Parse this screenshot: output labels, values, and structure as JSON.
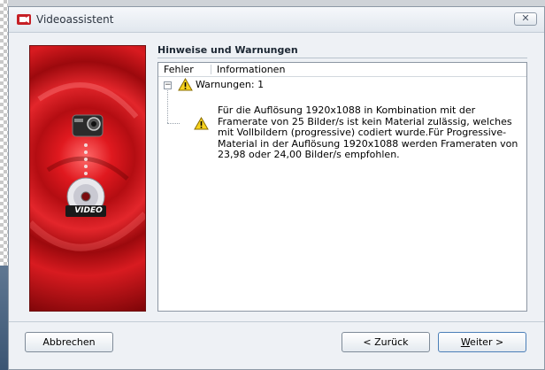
{
  "window": {
    "title": "Videoassistent",
    "close_label": "✕"
  },
  "banner": {
    "device_label": "VIDEO"
  },
  "section": {
    "title": "Hinweise und Warnungen"
  },
  "list": {
    "columns": [
      "Fehler",
      "Informationen"
    ],
    "expander_symbol": "−",
    "group_label": "Warnungen: 1",
    "message": "Für die Auflösung 1920x1088 in Kombination mit der Framerate von 25 Bilder/s ist kein Material zulässig, welches mit Vollbildern (progressive) codiert wurde.Für Progressive-Material in der Auflösung 1920x1088 werden Frameraten von 23,98 oder 24,00 Bilder/s empfohlen."
  },
  "buttons": {
    "cancel": "Abbrechen",
    "back": "< Zurück",
    "next_prefix": "W",
    "next_rest": "eiter >"
  },
  "colors": {
    "accent_red": "#d81b20",
    "warning_yellow": "#f7d21d"
  }
}
